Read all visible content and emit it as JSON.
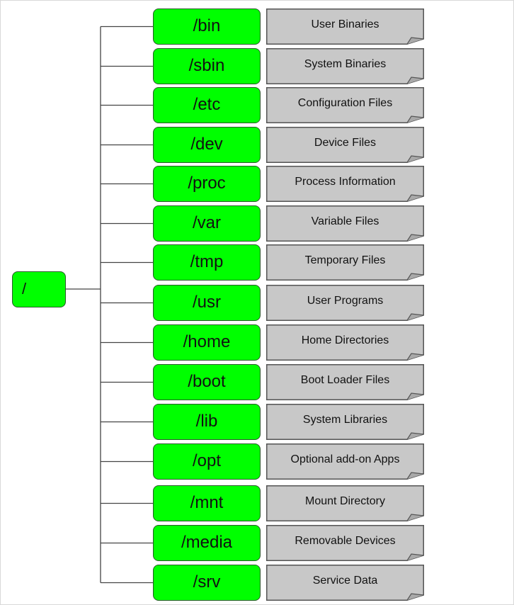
{
  "root": {
    "label": "/"
  },
  "directories": [
    {
      "path": "/bin",
      "description": "User Binaries"
    },
    {
      "path": "/sbin",
      "description": "System Binaries"
    },
    {
      "path": "/etc",
      "description": "Configuration Files"
    },
    {
      "path": "/dev",
      "description": "Device Files"
    },
    {
      "path": "/proc",
      "description": "Process Information"
    },
    {
      "path": "/var",
      "description": "Variable Files"
    },
    {
      "path": "/tmp",
      "description": "Temporary Files"
    },
    {
      "path": "/usr",
      "description": "User Programs"
    },
    {
      "path": "/home",
      "description": "Home Directories"
    },
    {
      "path": "/boot",
      "description": "Boot Loader Files"
    },
    {
      "path": "/lib",
      "description": "System Libraries"
    },
    {
      "path": "/opt",
      "description": "Optional add-on Apps"
    },
    {
      "path": "/mnt",
      "description": "Mount Directory"
    },
    {
      "path": "/media",
      "description": "Removable Devices"
    },
    {
      "path": "/srv",
      "description": "Service Data"
    }
  ],
  "colors": {
    "node_fill": "#00ff00",
    "node_border": "#2a5a2a",
    "note_fill": "#c8c8c8",
    "note_border": "#555555",
    "connector": "#444444"
  }
}
